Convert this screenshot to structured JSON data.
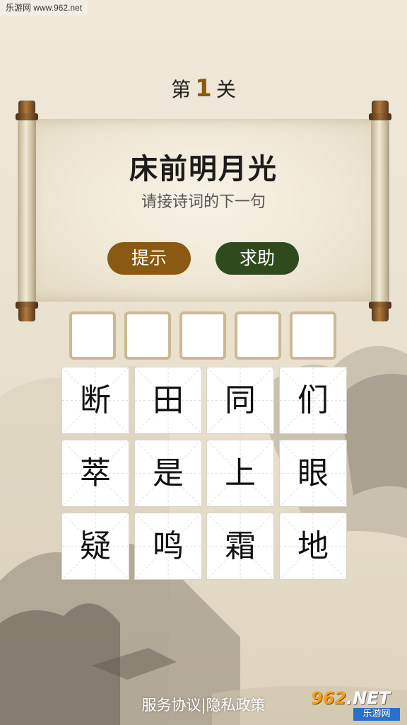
{
  "watermark_top": "乐游网 www.962.net",
  "level": {
    "prefix": "第",
    "number": "1",
    "suffix": "关"
  },
  "verse": "床前明月光",
  "instruction": "请接诗词的下一句",
  "buttons": {
    "hint": "提示",
    "help": "求助"
  },
  "answer_slots": [
    "",
    "",
    "",
    "",
    ""
  ],
  "characters": [
    [
      "断",
      "田",
      "同",
      "们"
    ],
    [
      "萃",
      "是",
      "上",
      "眼"
    ],
    [
      "疑",
      "鸣",
      "霜",
      "地"
    ]
  ],
  "footer": {
    "terms": "服务协议",
    "separator": "|",
    "privacy": "隐私政策"
  },
  "watermark_bottom": {
    "brand": "962",
    "domain": ".NET",
    "name": "乐游网"
  },
  "colors": {
    "hint_button": "#8a5a13",
    "help_button": "#2f4a1c",
    "level_number": "#8a5a13"
  }
}
